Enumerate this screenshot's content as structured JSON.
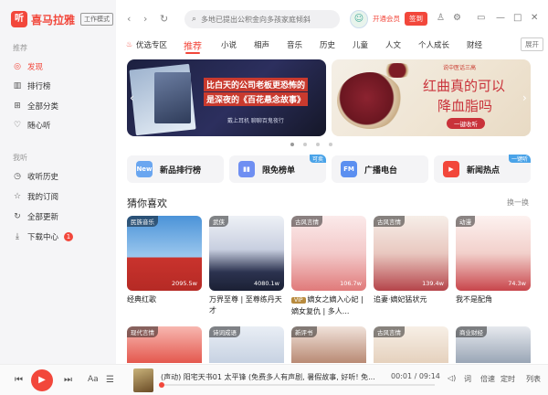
{
  "app": {
    "logo_mark": "听",
    "name": "喜马拉雅",
    "work_mode": "工作模式"
  },
  "sidebar": {
    "section_recommend": "推荐",
    "section_my": "我听",
    "items_top": [
      {
        "label": "发现",
        "icon": "compass-icon"
      },
      {
        "label": "排行榜",
        "icon": "chart-icon"
      },
      {
        "label": "全部分类",
        "icon": "grid-icon"
      },
      {
        "label": "随心听",
        "icon": "heart-icon"
      }
    ],
    "items_my": [
      {
        "label": "收听历史",
        "icon": "clock-icon"
      },
      {
        "label": "我的订阅",
        "icon": "star-icon"
      },
      {
        "label": "全部更新",
        "icon": "refresh-icon"
      },
      {
        "label": "下载中心",
        "icon": "download-icon",
        "badge": "1"
      }
    ]
  },
  "topbar": {
    "search_placeholder": "多地已提出公积金向多孩家庭倾斜",
    "vip_link": "开通会员",
    "sign_label": "签到"
  },
  "categories": {
    "items": [
      "优选专区",
      "推荐",
      "小说",
      "相声",
      "音乐",
      "历史",
      "儿童",
      "人文",
      "个人成长",
      "财经"
    ],
    "active": "推荐",
    "expand": "展开"
  },
  "banners": [
    {
      "line1": "比白天的公司老板更恐怖的",
      "line2": "是深夜的《百花悬念故事》",
      "sub": "戴上耳机  聊聊百鬼夜行"
    },
    {
      "tag": "说中医话三高",
      "line1": "红曲真的可以",
      "line2": "降血脂吗",
      "button": "一键收听"
    }
  ],
  "quick_links": [
    {
      "label": "新品排行榜",
      "icon_text": "New",
      "color": "#6aa6f0"
    },
    {
      "label": "限免榜单",
      "icon_text": "▮▮",
      "color": "#6f8ff2",
      "tag": "可卖"
    },
    {
      "label": "广播电台",
      "icon_text": "FM",
      "color": "#5b8ff0"
    },
    {
      "label": "新闻热点",
      "icon_text": "▶",
      "color": "#f2473b",
      "tag": "一键听"
    }
  ],
  "recommend": {
    "title": "猜你喜欢",
    "refresh": "换一换",
    "cards": [
      {
        "tag": "民族音乐",
        "plays": "2095.5w",
        "title": "经典红歌",
        "vip": false
      },
      {
        "tag": "武侠",
        "plays": "4080.1w",
        "title": "万界至尊 | 至尊练丹天才",
        "vip": false
      },
      {
        "tag": "古风言情",
        "plays": "106.7w",
        "title": "嫡女之嫡入心妃 | 嫡女复仇 | 多人...",
        "vip": true,
        "vip_label": "VIP"
      },
      {
        "tag": "古风言情",
        "plays": "139.4w",
        "title": "追妻·嫡妃猛状元",
        "vip": false
      },
      {
        "tag": "动漫",
        "plays": "74.3w",
        "title": "我不是配角",
        "vip": false
      }
    ],
    "row2_tags": [
      "现代言情",
      "诗词成语",
      "新评书",
      "古风言情",
      "商业财经"
    ]
  },
  "player": {
    "track": "(声动)    阳宅天书01 太平锋 (免费多人有声剧, 暑假故事, 好听! 免...",
    "time": "00:01 / 09:14",
    "progress": 0,
    "controls": [
      "词",
      "倍速",
      "定时",
      "列表"
    ]
  }
}
